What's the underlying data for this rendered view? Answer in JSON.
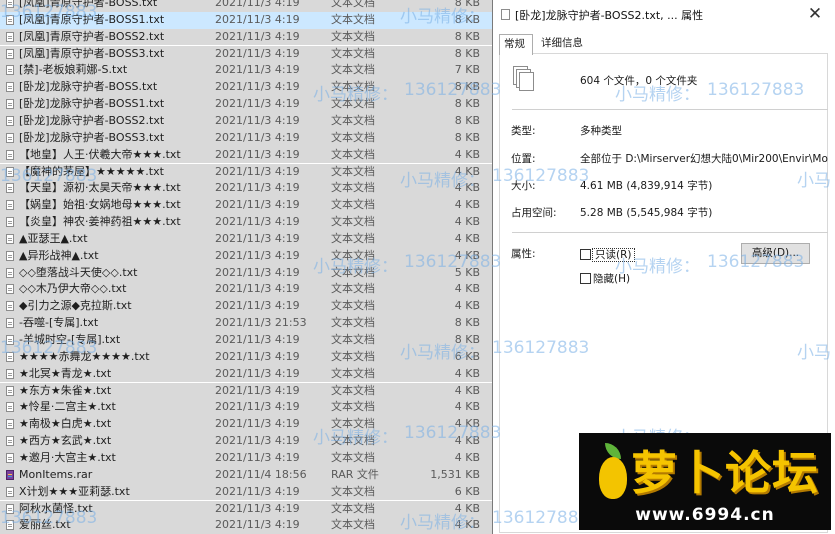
{
  "file_list": {
    "rows": [
      {
        "name": "[凤凰]青原守护者-BOSS.txt",
        "date": "2021/11/3 4:19",
        "type": "文本文档",
        "size": "8 KB"
      },
      {
        "name": "[凤凰]青原守护者-BOSS1.txt",
        "date": "2021/11/3 4:19",
        "type": "文本文档",
        "size": "8 KB",
        "selected": true
      },
      {
        "name": "[凤凰]青原守护者-BOSS2.txt",
        "date": "2021/11/3 4:19",
        "type": "文本文档",
        "size": "8 KB"
      },
      {
        "name": "[凤凰]青原守护者-BOSS3.txt",
        "date": "2021/11/3 4:19",
        "type": "文本文档",
        "size": "8 KB"
      },
      {
        "name": "[禁]-老板娘莉娜-S.txt",
        "date": "2021/11/3 4:19",
        "type": "文本文档",
        "size": "7 KB"
      },
      {
        "name": "[卧龙]龙脉守护者-BOSS.txt",
        "date": "2021/11/3 4:19",
        "type": "文本文档",
        "size": "8 KB"
      },
      {
        "name": "[卧龙]龙脉守护者-BOSS1.txt",
        "date": "2021/11/3 4:19",
        "type": "文本文档",
        "size": "8 KB"
      },
      {
        "name": "[卧龙]龙脉守护者-BOSS2.txt",
        "date": "2021/11/3 4:19",
        "type": "文本文档",
        "size": "8 KB"
      },
      {
        "name": "[卧龙]龙脉守护者-BOSS3.txt",
        "date": "2021/11/3 4:19",
        "type": "文本文档",
        "size": "8 KB"
      },
      {
        "name": "【地皇】人王·伏羲大帝★★★.txt",
        "date": "2021/11/3 4:19",
        "type": "文本文档",
        "size": "4 KB"
      },
      {
        "name": "【魔神的茅屋】★★★★★.txt",
        "date": "2021/11/3 4:19",
        "type": "文本文档",
        "size": "4 KB"
      },
      {
        "name": "【天皇】源初·太昊天帝★★★.txt",
        "date": "2021/11/3 4:19",
        "type": "文本文档",
        "size": "4 KB"
      },
      {
        "name": "【娲皇】始祖·女娲地母★★★.txt",
        "date": "2021/11/3 4:19",
        "type": "文本文档",
        "size": "4 KB"
      },
      {
        "name": "【炎皇】神农·姜神药祖★★★.txt",
        "date": "2021/11/3 4:19",
        "type": "文本文档",
        "size": "4 KB"
      },
      {
        "name": "▲亚瑟王▲.txt",
        "date": "2021/11/3 4:19",
        "type": "文本文档",
        "size": "4 KB"
      },
      {
        "name": "▲异形战神▲.txt",
        "date": "2021/11/3 4:19",
        "type": "文本文档",
        "size": "4 KB"
      },
      {
        "name": "◇◇堕落战斗天使◇◇.txt",
        "date": "2021/11/3 4:19",
        "type": "文本文档",
        "size": "5 KB"
      },
      {
        "name": "◇◇木乃伊大帝◇◇.txt",
        "date": "2021/11/3 4:19",
        "type": "文本文档",
        "size": "4 KB"
      },
      {
        "name": "◆引力之源◆克拉斯.txt",
        "date": "2021/11/3 4:19",
        "type": "文本文档",
        "size": "4 KB"
      },
      {
        "name": "-吞噬-[专属].txt",
        "date": "2021/11/3 21:53",
        "type": "文本文档",
        "size": "8 KB"
      },
      {
        "name": "-羊城时空-[专属].txt",
        "date": "2021/11/3 4:19",
        "type": "文本文档",
        "size": "8 KB"
      },
      {
        "name": "★★★★赤舞龙★★★★.txt",
        "date": "2021/11/3 4:19",
        "type": "文本文档",
        "size": "6 KB"
      },
      {
        "name": "★北冥★青龙★.txt",
        "date": "2021/11/3 4:19",
        "type": "文本文档",
        "size": "4 KB"
      },
      {
        "name": "★东方★朱雀★.txt",
        "date": "2021/11/3 4:19",
        "type": "文本文档",
        "size": "4 KB"
      },
      {
        "name": "★怜星·二宫主★.txt",
        "date": "2021/11/3 4:19",
        "type": "文本文档",
        "size": "4 KB"
      },
      {
        "name": "★南极★白虎★.txt",
        "date": "2021/11/3 4:19",
        "type": "文本文档",
        "size": "4 KB"
      },
      {
        "name": "★西方★玄武★.txt",
        "date": "2021/11/3 4:19",
        "type": "文本文档",
        "size": "4 KB"
      },
      {
        "name": "★邀月·大宫主★.txt",
        "date": "2021/11/3 4:19",
        "type": "文本文档",
        "size": "4 KB"
      },
      {
        "name": "MonItems.rar",
        "date": "2021/11/4 18:56",
        "type": "RAR 文件",
        "size": "1,531 KB",
        "icon": "rar"
      },
      {
        "name": "X计划★★★亚莉瑟.txt",
        "date": "2021/11/3 4:19",
        "type": "文本文档",
        "size": "6 KB"
      },
      {
        "name": "阿秋水菌怪.txt",
        "date": "2021/11/3 4:19",
        "type": "文本文档",
        "size": "4 KB"
      },
      {
        "name": "爱丽丝.txt",
        "date": "2021/11/3 4:19",
        "type": "文本文档",
        "size": "4 KB"
      }
    ]
  },
  "dialog": {
    "title": "[卧龙]龙脉守护者-BOSS2.txt, ... 属性",
    "close_glyph": "✕",
    "tabs": [
      {
        "label": "常规"
      },
      {
        "label": "详细信息"
      }
    ],
    "summary": "604 个文件，0 个文件夹",
    "type_label": "类型:",
    "type_value": "多种类型",
    "location_label": "位置:",
    "location_value": "全部位于 D:\\Mirserver幻想大陆0\\Mir200\\Envir\\Mo",
    "size_label": "大小:",
    "size_value": "4.61 MB (4,839,914 字节)",
    "disk_label": "占用空间:",
    "disk_value": "5.28 MB (5,545,984 字节)",
    "attr_label": "属性:",
    "readonly_label": "只读(R)",
    "hidden_label": "隐藏(H)",
    "advanced_label": "高级(D)..."
  },
  "watermark": {
    "text_a": "小马精修：",
    "text_b": "136127883",
    "text_c": "小马",
    "color": "#78afe6"
  },
  "logo": {
    "main": "萝卜论坛",
    "url": "www.6994.cn",
    "colors": {
      "yellow": "#f5c400",
      "background": "#0a0a0a"
    }
  }
}
